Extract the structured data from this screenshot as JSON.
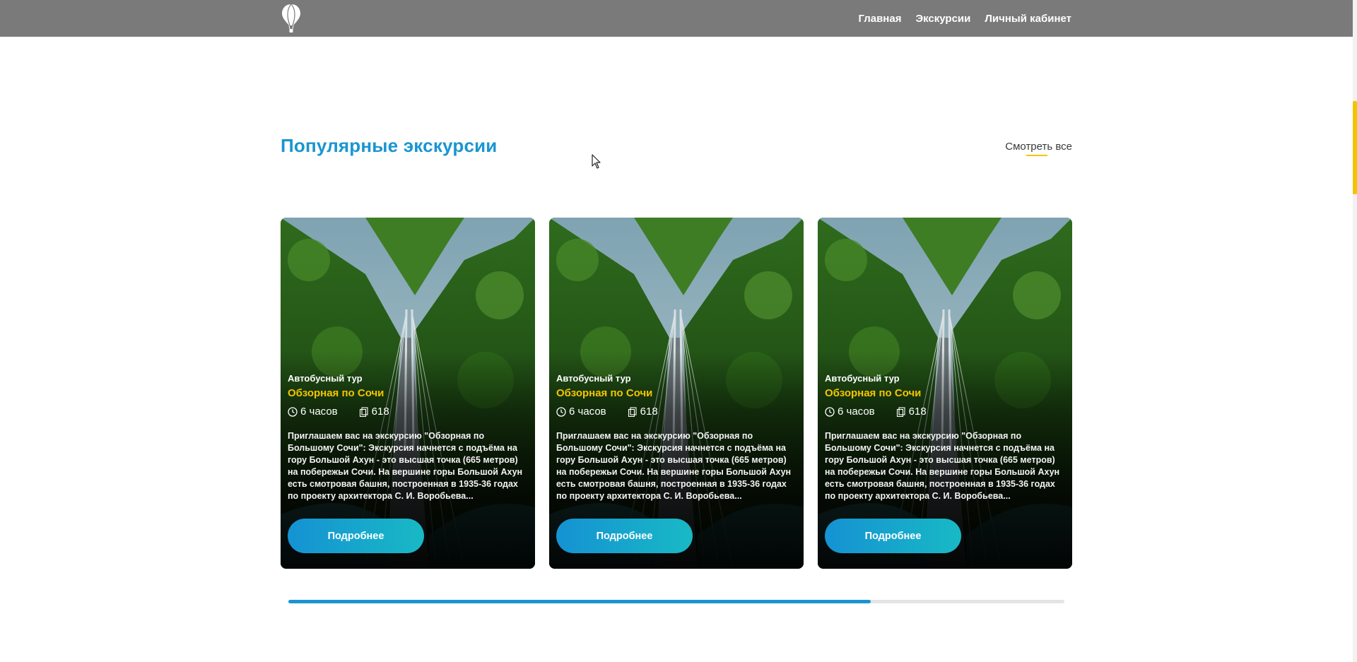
{
  "nav": {
    "logo": "hot-air-balloon-logo",
    "links": [
      "Главная",
      "Экскурсии",
      "Личный кабинет"
    ]
  },
  "section": {
    "title": "Популярные экскурсии",
    "see_all": "Смотреть все"
  },
  "cards": [
    {
      "type": "Автобусный тур",
      "title": "Обзорная по Сочи",
      "duration": "6 часов",
      "count": "618",
      "description": "Приглашаем вас на экскурсию \"Обзорная по Большому Сочи\": Экскурсия начнется с подъёма на гору Большой Ахун - это высшая точка (665 метров) на побережьи Сочи. На вершине горы Большой Ахун есть смотровая башня, построенная в 1935-36 годах по проекту архитектора С. И. Воробьева...",
      "button": "Подробнее"
    },
    {
      "type": "Автобусный тур",
      "title": "Обзорная по Сочи",
      "duration": "6 часов",
      "count": "618",
      "description": "Приглашаем вас на экскурсию \"Обзорная по Большому Сочи\": Экскурсия начнется с подъёма на гору Большой Ахун - это высшая точка (665 метров) на побережьи Сочи. На вершине горы Большой Ахун есть смотровая башня, построенная в 1935-36 годах по проекту архитектора С. И. Воробьева...",
      "button": "Подробнее"
    },
    {
      "type": "Автобусный тур",
      "title": "Обзорная по Сочи",
      "duration": "6 часов",
      "count": "618",
      "description": "Приглашаем вас на экскурсию \"Обзорная по Большому Сочи\": Экскурсия начнется с подъёма на гору Большой Ахун - это высшая точка (665 метров) на побережьи Сочи. На вершине горы Большой Ахун есть смотровая башня, построенная в 1935-36 годах по проекту архитектора С. И. Воробьева...",
      "button": "Подробнее"
    }
  ],
  "carousel": {
    "progress_fraction": 0.75
  },
  "colors": {
    "accent_blue": "#1a95d1",
    "accent_yellow": "#f5c400",
    "navbar": "#7a7a7a"
  },
  "icons": {
    "duration": "clock-icon",
    "count": "copies-icon"
  }
}
